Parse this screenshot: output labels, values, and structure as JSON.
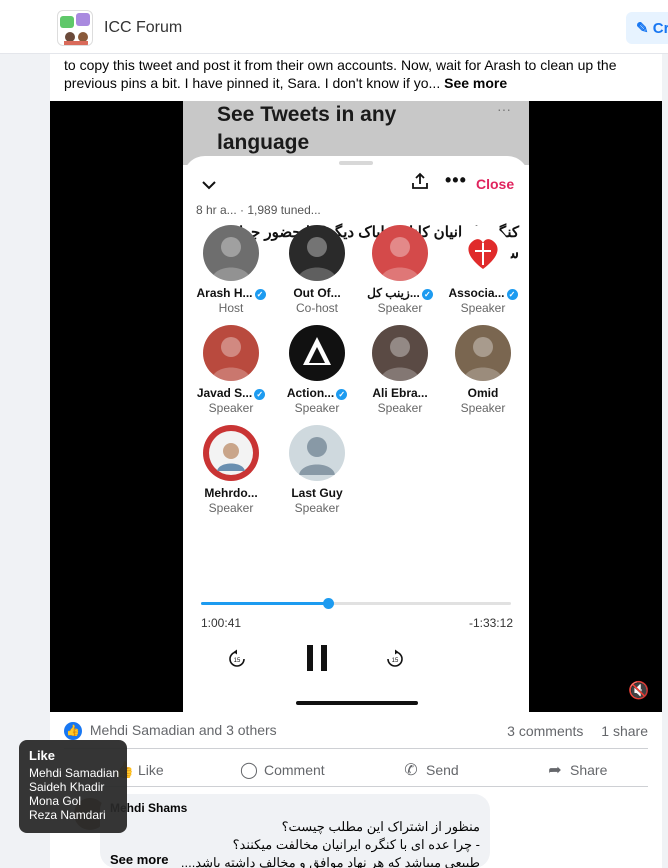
{
  "header": {
    "group_name": "ICC Forum",
    "create_label": "Cr"
  },
  "post": {
    "text": "to copy this tweet and post it from their own accounts. Now, wait for Arash to clean up the previous pins a bit. I have pinned it, Sara. I don't know if yo...",
    "see_more": "See more"
  },
  "video": {
    "banner": "See Tweets in any language",
    "close_label": "Close",
    "meta": "8 hr a... · 1,989 tuned...",
    "space_title": "کنگره ایرانیان کانادا، ناپاک دیگر؟ با حضور جواد سلیمانی",
    "speakers": [
      {
        "name": "Arash H...",
        "role": "Host",
        "verified": true,
        "role_icon": "person-icon",
        "color": "#6e6e6e"
      },
      {
        "name": "Out Of...",
        "role": "Co-host",
        "verified": false,
        "color": "#2a2a2a"
      },
      {
        "name": "زینب کل...",
        "role": "Speaker",
        "verified": true,
        "role_icon": "mic-icon",
        "color": "#d44a4a"
      },
      {
        "name": "Associa...",
        "role": "Speaker",
        "verified": true,
        "color": "#ffffff"
      },
      {
        "name": "Javad S...",
        "role": "Speaker",
        "verified": true,
        "color": "#b94a3e"
      },
      {
        "name": "Action...",
        "role": "Speaker",
        "verified": true,
        "color": "#111111"
      },
      {
        "name": "Ali Ebra...",
        "role": "Speaker",
        "verified": false,
        "color": "#5a4a44"
      },
      {
        "name": "Omid",
        "role": "Speaker",
        "verified": false,
        "color": "#7a6650"
      },
      {
        "name": "Mehrdo...",
        "role": "Speaker",
        "verified": false,
        "color": "#c93434"
      },
      {
        "name": "Last Guy",
        "role": "Speaker",
        "verified": false,
        "color": "#cfd9de"
      }
    ],
    "progress": 0.41,
    "time_elapsed": "1:00:41",
    "time_remaining": "-1:33:12",
    "skip_back": "15",
    "skip_forward": "15"
  },
  "reactions": {
    "text": "Mehdi Samadian and 3 others",
    "comments": "3 comments",
    "shares": "1 share"
  },
  "actions": {
    "like": "Like",
    "comment": "Comment",
    "send": "Send",
    "share": "Share"
  },
  "comment": {
    "author": "Mehdi Shams",
    "line1": "منظور از اشتراک این مطلب چیست؟",
    "line2": "- چرا عده ای با کنگره ایرانیان مخالفت میکنند؟",
    "line3": "طبیعی میباشد که هر نهاد موافق و مخالف داشته باشد....",
    "see_more": "See more"
  },
  "tooltip": {
    "title": "Like",
    "names": [
      "Mehdi Samadian",
      "Saideh Khadir",
      "Mona Gol",
      "Reza Namdari"
    ]
  },
  "colors": {
    "accent": "#1877f2",
    "twitter_blue": "#1d9bf0",
    "close_red": "#e0245e"
  }
}
